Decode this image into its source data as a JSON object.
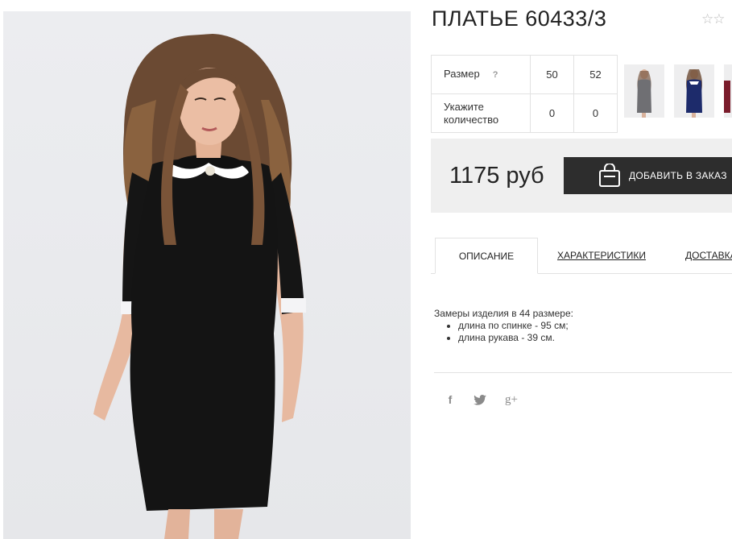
{
  "product": {
    "title": "ПЛАТЬЕ 60433/3",
    "rating_stars": "☆☆",
    "image_alt": "Black dress with lace collar"
  },
  "size_table": {
    "size_label": "Размер",
    "help_mark": "?",
    "qty_label": "Укажите количество",
    "sizes": [
      "50",
      "52"
    ],
    "quantities": [
      "0",
      "0"
    ]
  },
  "thumbnails": [
    "grey-dress-thumb",
    "blue-dress-thumb",
    "third-thumb"
  ],
  "purchase": {
    "price": "1175 руб",
    "add_button": "ДОБАВИТЬ В ЗАКАЗ"
  },
  "tabs": [
    {
      "label": "ОПИСАНИЕ",
      "active": true
    },
    {
      "label": "ХАРАКТЕРИСТИКИ",
      "active": false
    },
    {
      "label": "ДОСТАВКА",
      "active": false
    }
  ],
  "description": {
    "intro": "Замеры изделия в 44 размере:",
    "items": [
      "длина по спинке - 95 см;",
      "длина рукава - 39 см."
    ]
  },
  "social": {
    "icons": [
      "facebook-icon",
      "twitter-icon",
      "google-plus-icon"
    ],
    "facebook": "f",
    "google_plus": "g+"
  },
  "colors": {
    "button_bg": "#2d2d2d",
    "price_box_bg": "#efefef",
    "border": "#e2e2e2"
  }
}
